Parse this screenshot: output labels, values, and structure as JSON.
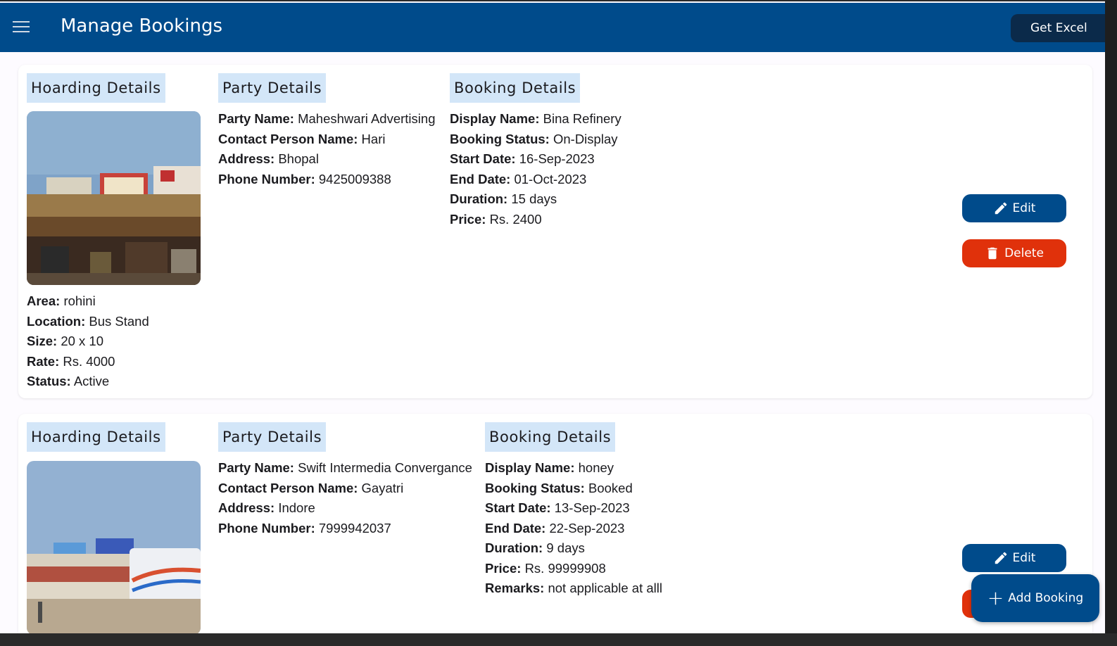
{
  "appbar": {
    "title": "Manage Bookings",
    "excel_label": "Get Excel"
  },
  "bookings": [
    {
      "hoarding": {
        "heading": "Hoarding Details",
        "rows": [
          {
            "label": "Area:",
            "value": "rohini"
          },
          {
            "label": "Location:",
            "value": "Bus Stand"
          },
          {
            "label": "Size:",
            "value": "20 x 10"
          },
          {
            "label": "Rate:",
            "value": "Rs. 4000"
          },
          {
            "label": "Status:",
            "value": "Active"
          }
        ]
      },
      "party": {
        "heading": "Party Details",
        "rows": [
          {
            "label": "Party Name:",
            "value": "Maheshwari Advertising"
          },
          {
            "label": "Contact Person Name:",
            "value": "Hari"
          },
          {
            "label": "Address:",
            "value": "Bhopal"
          },
          {
            "label": "Phone Number:",
            "value": "9425009388"
          }
        ]
      },
      "booking": {
        "heading": "Booking Details",
        "rows": [
          {
            "label": "Display Name:",
            "value": "Bina Refinery"
          },
          {
            "label": "Booking Status:",
            "value": "On-Display"
          },
          {
            "label": "Start Date:",
            "value": "16-Sep-2023"
          },
          {
            "label": "End Date:",
            "value": "01-Oct-2023"
          },
          {
            "label": "Duration:",
            "value": "15 days"
          },
          {
            "label": "Price:",
            "value": "Rs. 2400"
          }
        ]
      },
      "edit_label": "Edit",
      "delete_label": "Delete"
    },
    {
      "hoarding": {
        "heading": "Hoarding Details",
        "rows": []
      },
      "party": {
        "heading": "Party Details",
        "rows": [
          {
            "label": "Party Name:",
            "value": "Swift Intermedia Convergance"
          },
          {
            "label": "Contact Person Name:",
            "value": "Gayatri"
          },
          {
            "label": "Address:",
            "value": "Indore"
          },
          {
            "label": "Phone Number:",
            "value": "7999942037"
          }
        ]
      },
      "booking": {
        "heading": "Booking Details",
        "rows": [
          {
            "label": "Display Name:",
            "value": "honey"
          },
          {
            "label": "Booking Status:",
            "value": "Booked"
          },
          {
            "label": "Start Date:",
            "value": "13-Sep-2023"
          },
          {
            "label": "End Date:",
            "value": "22-Sep-2023"
          },
          {
            "label": "Duration:",
            "value": "9 days"
          },
          {
            "label": "Price:",
            "value": "Rs. 99999908"
          },
          {
            "label": "Remarks:",
            "value": "not applicable at alll"
          }
        ]
      },
      "edit_label": "Edit"
    }
  ],
  "fab": {
    "label": "Add Booking"
  },
  "colors": {
    "primary": "#004b8b",
    "danger": "#e0310b",
    "heading_bg": "#d3e6f8"
  }
}
